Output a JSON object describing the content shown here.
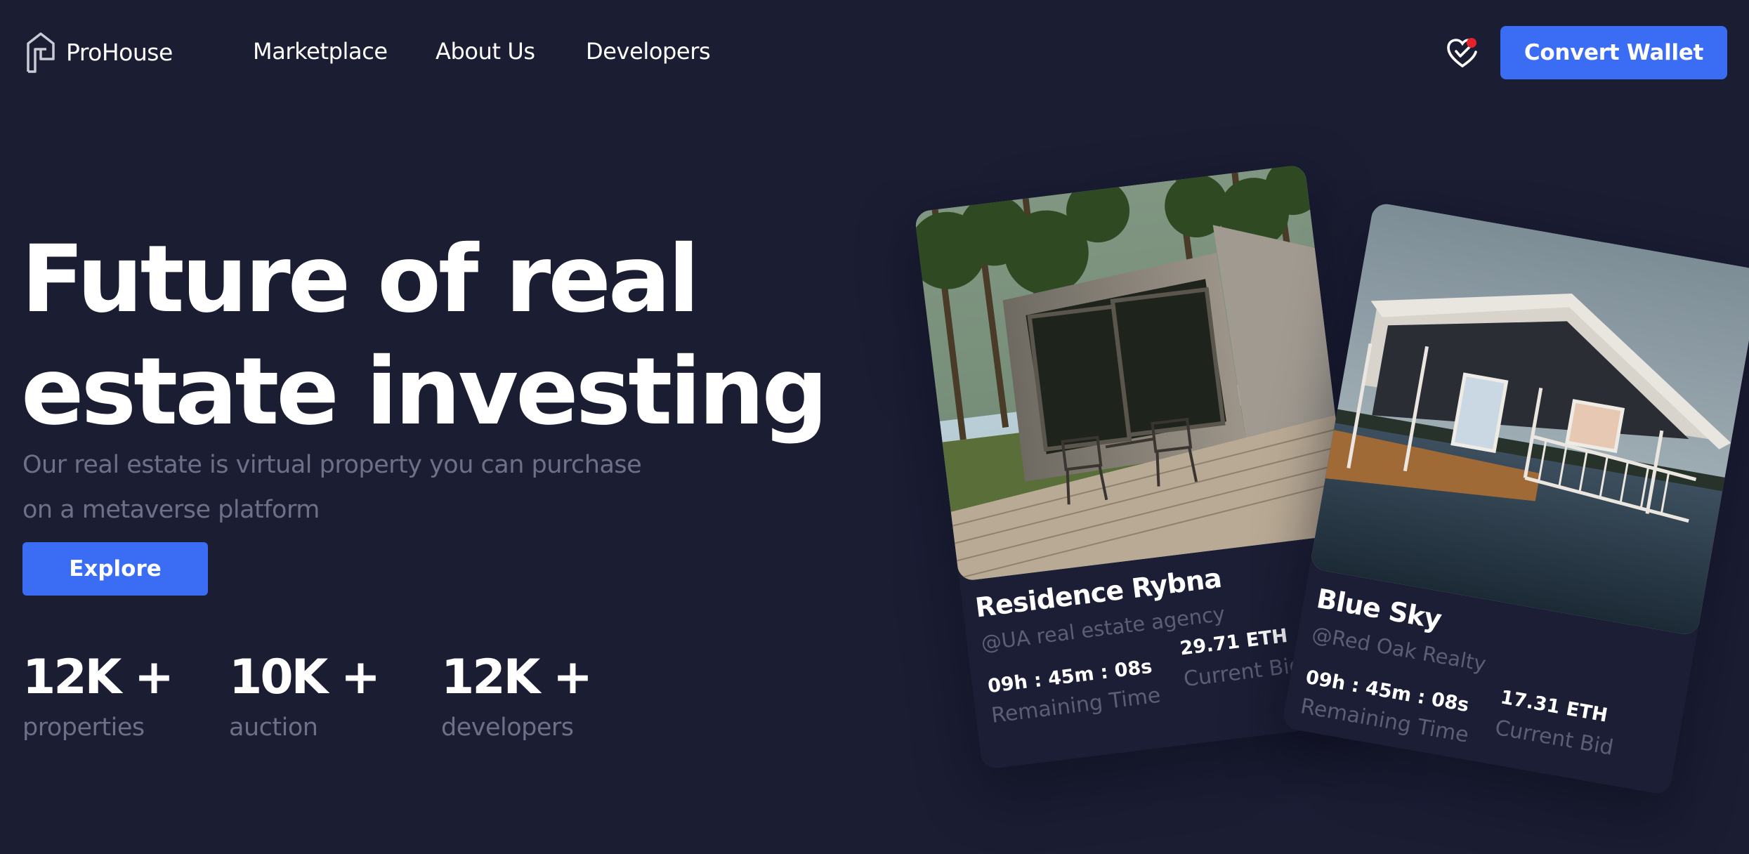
{
  "brand": {
    "name": "ProHouse",
    "icon": "house-logo-icon"
  },
  "nav": {
    "links": [
      "Marketplace",
      "About Us",
      "Developers"
    ]
  },
  "header": {
    "favorites_icon": "heart-icon",
    "notification_dot_color": "#e7212c",
    "convert_label": "Convert Wallet"
  },
  "hero": {
    "title_line1": "Future of real",
    "title_line2": "estate investing",
    "subtitle": "Our real estate is virtual property you can purchase on a metaverse platform",
    "explore_label": "Explore"
  },
  "stats": [
    {
      "value": "12K +",
      "label": "properties"
    },
    {
      "value": "10K +",
      "label": "auction"
    },
    {
      "value": "12K +",
      "label": "developers"
    }
  ],
  "cards": [
    {
      "title": "Residence Rybna",
      "agency": "@UA real estate agency",
      "time": "09h : 45m : 08s",
      "time_label": "Remaining Time",
      "bid": "29.71 ETH",
      "bid_label": "Current Bid",
      "image": "modern-cabin-in-forest"
    },
    {
      "title": "Blue Sky",
      "agency": "@Red Oak Realty",
      "time": "09h : 45m : 08s",
      "time_label": "Remaining Time",
      "bid": "17.31 ETH",
      "bid_label": "Current Bid",
      "image": "wooden-house-on-water"
    }
  ],
  "colors": {
    "background": "#1b1d33",
    "accent": "#3a6cf4",
    "muted_text": "#6e7089",
    "card": "#1c1e35"
  }
}
